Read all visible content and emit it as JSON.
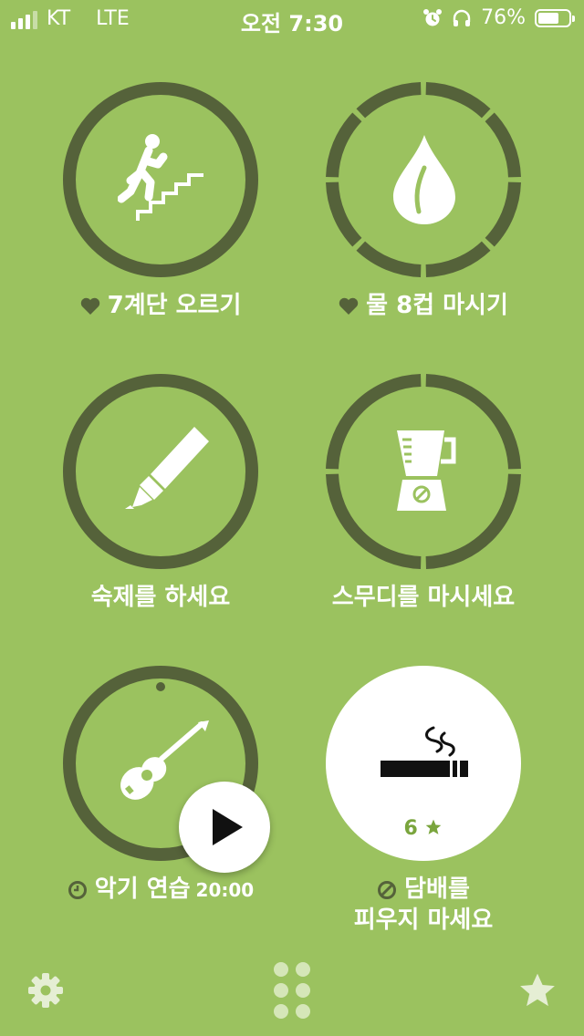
{
  "status_bar": {
    "carrier": "KT",
    "network": "LTE",
    "time": "오전 7:30",
    "battery_percent": "76%",
    "battery_level": 0.76,
    "icons": [
      "signal-icon",
      "alarm-icon",
      "headphones-icon",
      "battery-icon"
    ]
  },
  "habits": [
    {
      "id": "stairs",
      "label": "7계단 오르기",
      "label_icon": "heart-icon",
      "icon": "stairs-icon",
      "ring": "solid"
    },
    {
      "id": "water",
      "label": "물 8컵 마시기",
      "label_icon": "heart-icon",
      "icon": "water-drop-icon",
      "ring": "segmented",
      "segments": 8,
      "completed": 8
    },
    {
      "id": "homework",
      "label": "숙제를 하세요",
      "icon": "highlighter-icon",
      "ring": "solid"
    },
    {
      "id": "smoothie",
      "label": "스무디를 마시세요",
      "icon": "blender-icon",
      "ring": "segmented",
      "segments": 4,
      "completed": 4
    },
    {
      "id": "instrument",
      "label": "악기 연습",
      "label_icon": "clock-icon",
      "time": "20:00",
      "icon": "guitar-icon",
      "ring": "solid"
    },
    {
      "id": "no-smoking",
      "label_line1": "담배를",
      "label_line2": "피우지 마세요",
      "label_icon": "ban-icon",
      "icon": "cigarette-icon",
      "stars": "6"
    }
  ],
  "bottom_bar": {
    "icons": [
      "settings-icon",
      "grid-icon",
      "star-icon"
    ]
  },
  "colors": {
    "background": "#9bc25f",
    "ring": "#55623a",
    "white": "#ffffff",
    "star_text": "#7aa53d"
  }
}
